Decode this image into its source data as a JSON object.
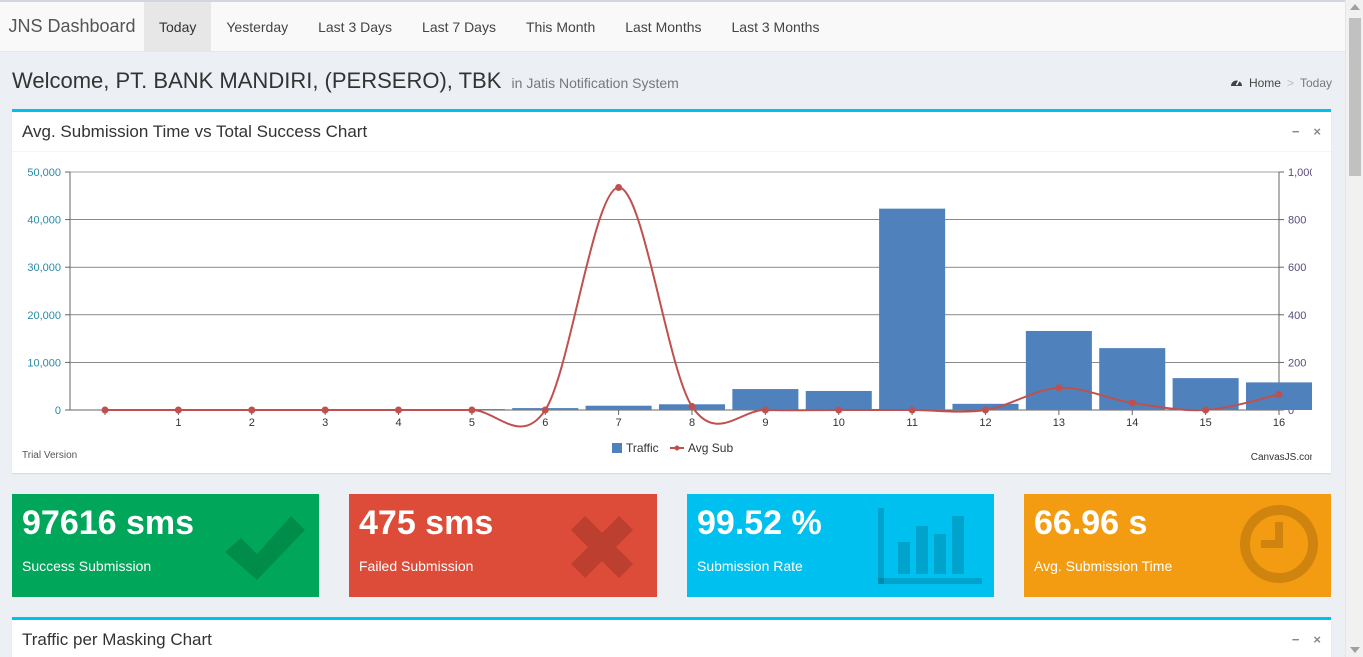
{
  "navbar": {
    "brand": "JNS Dashboard",
    "tabs": [
      {
        "label": "Today",
        "active": true
      },
      {
        "label": "Yesterday",
        "active": false
      },
      {
        "label": "Last 3 Days",
        "active": false
      },
      {
        "label": "Last 7 Days",
        "active": false
      },
      {
        "label": "This Month",
        "active": false
      },
      {
        "label": "Last Months",
        "active": false
      },
      {
        "label": "Last 3 Months",
        "active": false
      }
    ]
  },
  "header": {
    "welcome": "Welcome, PT. BANK MANDIRI, (PERSERO), TBK",
    "subtitle": "in Jatis Notification System",
    "breadcrumb": {
      "home": "Home",
      "current": "Today",
      "icon": "dashboard-icon"
    }
  },
  "chart_box": {
    "title": "Avg. Submission Time vs Total Success Chart",
    "tools": {
      "collapse": "−",
      "close": "×"
    },
    "trial_text": "Trial Version",
    "credit_text": "CanvasJS.com"
  },
  "chart_data": {
    "type": "bar",
    "categories": [
      "",
      "1",
      "2",
      "3",
      "4",
      "5",
      "6",
      "7",
      "8",
      "9",
      "10",
      "11",
      "12",
      "13",
      "14",
      "15",
      "16"
    ],
    "series": [
      {
        "name": "Traffic",
        "type": "bar",
        "axis": "left",
        "color": "#4f81bc",
        "values": [
          0,
          0,
          0,
          0,
          0,
          200,
          400,
          900,
          1200,
          4400,
          4000,
          42300,
          1300,
          16600,
          13000,
          6700,
          5800
        ]
      },
      {
        "name": "Avg Sub",
        "type": "spline",
        "axis": "right",
        "color": "#c0504e",
        "values": [
          0,
          0,
          0,
          0,
          0,
          0,
          0,
          935,
          15,
          0,
          0,
          0,
          0,
          93,
          30,
          0,
          65
        ]
      }
    ],
    "y_left": {
      "min": 0,
      "max": 50000,
      "ticks": [
        "0",
        "10,000",
        "20,000",
        "30,000",
        "40,000",
        "50,000"
      ]
    },
    "y_right": {
      "min": 0,
      "max": 1000,
      "ticks": [
        "0",
        "200",
        "400",
        "600",
        "800",
        "1,000"
      ]
    },
    "grid": true,
    "legend": "bottom-center"
  },
  "info_boxes": [
    {
      "value": "97616 sms",
      "label": "Success Submission",
      "icon": "check-icon",
      "color": "#00a65a"
    },
    {
      "value": "475 sms",
      "label": "Failed Submission",
      "icon": "times-icon",
      "color": "#dd4b39"
    },
    {
      "value": "99.52 %",
      "label": "Submission Rate",
      "icon": "bar-chart-icon",
      "color": "#00c0ef"
    },
    {
      "value": "66.96 s",
      "label": "Avg. Submission Time",
      "icon": "clock-icon",
      "color": "#f39c12"
    }
  ],
  "masking_box": {
    "title": "Traffic per Masking Chart",
    "tools": {
      "collapse": "−",
      "close": "×"
    }
  }
}
